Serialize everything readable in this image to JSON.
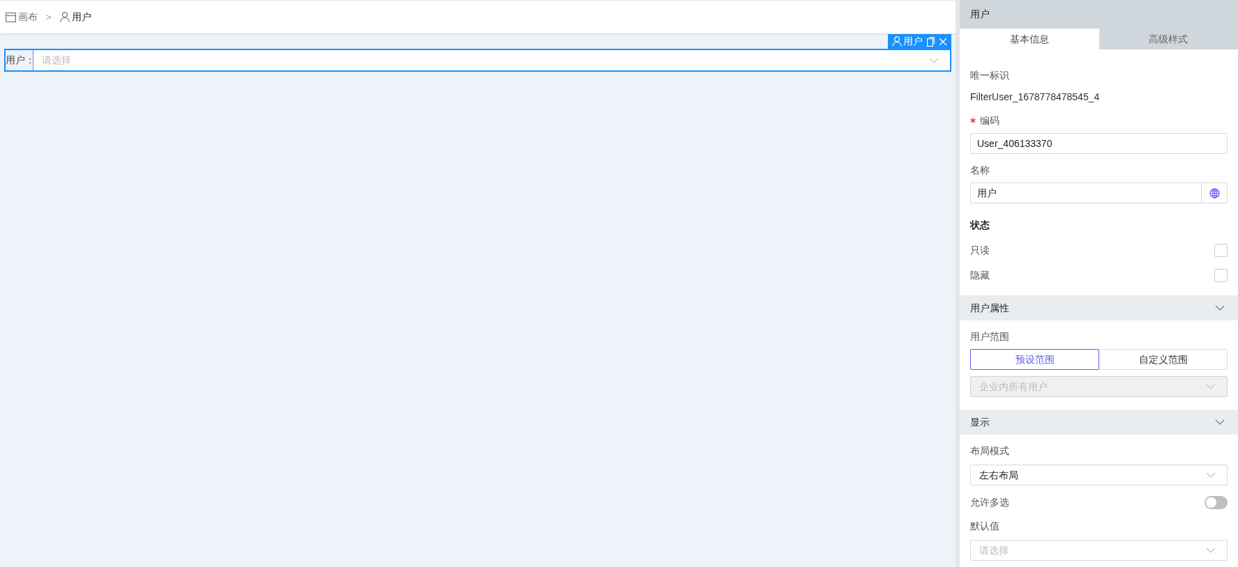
{
  "breadcrumb": {
    "items": [
      {
        "label": "画布",
        "kind": "canvas"
      },
      {
        "label": "用户",
        "kind": "user"
      }
    ],
    "separator": ">"
  },
  "canvas": {
    "selection_toolbar": {
      "label": "用户"
    },
    "field": {
      "label": "用户：",
      "placeholder": "请选择"
    }
  },
  "panel": {
    "title": "用户",
    "tabs": [
      {
        "label": "基本信息",
        "selected": true
      },
      {
        "label": "高级样式",
        "selected": false
      }
    ],
    "items": [
      {
        "kind": "label",
        "text": "唯一标识"
      },
      {
        "kind": "text",
        "text": "FilterUser_1678778478545_4"
      },
      {
        "kind": "label",
        "text": "编码",
        "required": true
      },
      {
        "kind": "input",
        "value": "User_406133370"
      },
      {
        "kind": "label",
        "text": "名称"
      },
      {
        "kind": "input",
        "value": "用户",
        "globe": true
      },
      {
        "kind": "heading",
        "text": "状态"
      },
      {
        "kind": "checkbox",
        "label": "只读",
        "checked": false
      },
      {
        "kind": "checkbox",
        "label": "隐藏",
        "checked": false
      },
      {
        "kind": "section",
        "title": "用户属性",
        "expanded": true
      },
      {
        "kind": "label",
        "text": "用户范围"
      },
      {
        "kind": "segmented",
        "options": [
          {
            "label": "预设范围",
            "selected": true
          },
          {
            "label": "自定义范围",
            "selected": false
          }
        ]
      },
      {
        "kind": "select",
        "value": "企业内所有用户",
        "disabled": true
      },
      {
        "kind": "section",
        "title": "显示",
        "expanded": true
      },
      {
        "kind": "label",
        "text": "布局模式"
      },
      {
        "kind": "select",
        "value": "左右布局",
        "disabled": false
      },
      {
        "kind": "switch",
        "label": "允许多选",
        "on": false
      },
      {
        "kind": "label",
        "text": "默认值"
      },
      {
        "kind": "select",
        "placeholder": "请选择",
        "disabled": false
      }
    ]
  }
}
